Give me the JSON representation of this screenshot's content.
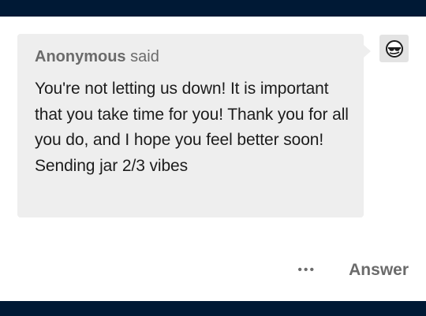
{
  "ask": {
    "asker_name": "Anonymous",
    "said_label": "said",
    "question": "You're not letting us down! It is important that you take time for you! Thank you for all you do, and I hope you feel better soon! Sending jar 2/3 vibes"
  },
  "actions": {
    "more_label": "•••",
    "answer_label": "Answer"
  },
  "avatar": {
    "icon": "anonymous-sunglasses-avatar-icon"
  },
  "colors": {
    "nav_background": "#001935",
    "bubble_background": "#eeeeee",
    "text_primary": "#1c1c1c",
    "text_secondary": "#6b6b6b"
  }
}
